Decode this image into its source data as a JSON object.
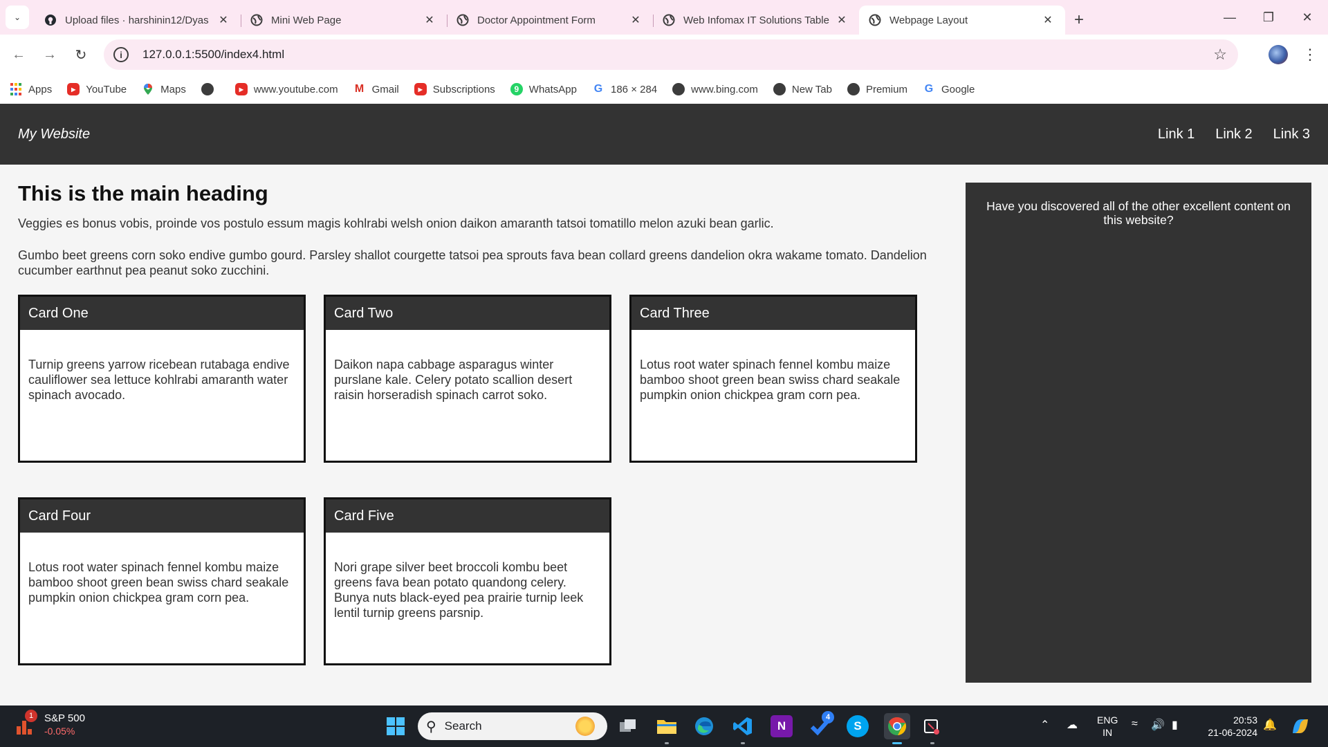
{
  "browser": {
    "tabs": [
      {
        "title": "Upload files · harshinin12/Dyas",
        "icon": "github-icon",
        "active": false
      },
      {
        "title": "Mini Web Page",
        "icon": "globe-icon",
        "active": false
      },
      {
        "title": "Doctor Appointment Form",
        "icon": "globe-icon",
        "active": false
      },
      {
        "title": "Web Infomax IT Solutions Table",
        "icon": "globe-icon",
        "active": false
      },
      {
        "title": "Webpage Layout",
        "icon": "globe-icon",
        "active": true
      }
    ],
    "url": "127.0.0.1:5500/index4.html",
    "bookmarks": [
      {
        "label": "Apps",
        "icon": "apps-icon"
      },
      {
        "label": "YouTube",
        "icon": "youtube-icon"
      },
      {
        "label": "Maps",
        "icon": "maps-icon"
      },
      {
        "label": "",
        "icon": "globe-icon"
      },
      {
        "label": "www.youtube.com",
        "icon": "youtube-icon"
      },
      {
        "label": "Gmail",
        "icon": "gmail-icon"
      },
      {
        "label": "Subscriptions",
        "icon": "youtube-icon"
      },
      {
        "label": "WhatsApp",
        "icon": "whatsapp-icon"
      },
      {
        "label": "186 × 284",
        "icon": "google-icon"
      },
      {
        "label": "www.bing.com",
        "icon": "globe-icon"
      },
      {
        "label": "New Tab",
        "icon": "globe-icon"
      },
      {
        "label": "Premium",
        "icon": "globe-icon"
      },
      {
        "label": "Google",
        "icon": "google-icon"
      }
    ]
  },
  "site": {
    "logo": "My Website",
    "nav": [
      "Link 1",
      "Link 2",
      "Link 3"
    ],
    "heading": "This is the main heading",
    "paragraphs": [
      "Veggies es bonus vobis, proinde vos postulo essum magis kohlrabi welsh onion daikon amaranth tatsoi tomatillo melon azuki bean garlic.",
      "Gumbo beet greens corn soko endive gumbo gourd. Parsley shallot courgette tatsoi pea sprouts fava bean collard greens dandelion okra wakame tomato. Dandelion cucumber earthnut pea peanut soko zucchini."
    ],
    "cards": [
      {
        "title": "Card One",
        "text": "Turnip greens yarrow ricebean rutabaga endive cauliflower sea lettuce kohlrabi amaranth water spinach avocado."
      },
      {
        "title": "Card Two",
        "text": "Daikon napa cabbage asparagus winter purslane kale. Celery potato scallion desert raisin horseradish spinach carrot soko."
      },
      {
        "title": "Card Three",
        "text": "Lotus root water spinach fennel kombu maize bamboo shoot green bean swiss chard seakale pumpkin onion chickpea gram corn pea."
      },
      {
        "title": "Card Four",
        "text": "Lotus root water spinach fennel kombu maize bamboo shoot green bean swiss chard seakale pumpkin onion chickpea gram corn pea."
      },
      {
        "title": "Card Five",
        "text": "Nori grape silver beet broccoli kombu beet greens fava bean potato quandong celery. Bunya nuts black-eyed pea prairie turnip leek lentil turnip greens parsnip."
      }
    ],
    "aside": "Have you discovered all of the other excellent content on this website?"
  },
  "taskbar": {
    "stock_name": "S&P 500",
    "stock_change": "-0.05%",
    "stock_badge": "1",
    "search_label": "Search",
    "todo_badge": "4",
    "lang": "ENG",
    "region": "IN",
    "time": "20:53",
    "date": "21-06-2024"
  },
  "colors": {
    "tabstrip": "#fce8f3",
    "site_header": "#333333",
    "page_bg": "#f5f5f5",
    "taskbar": "#1d2127"
  }
}
